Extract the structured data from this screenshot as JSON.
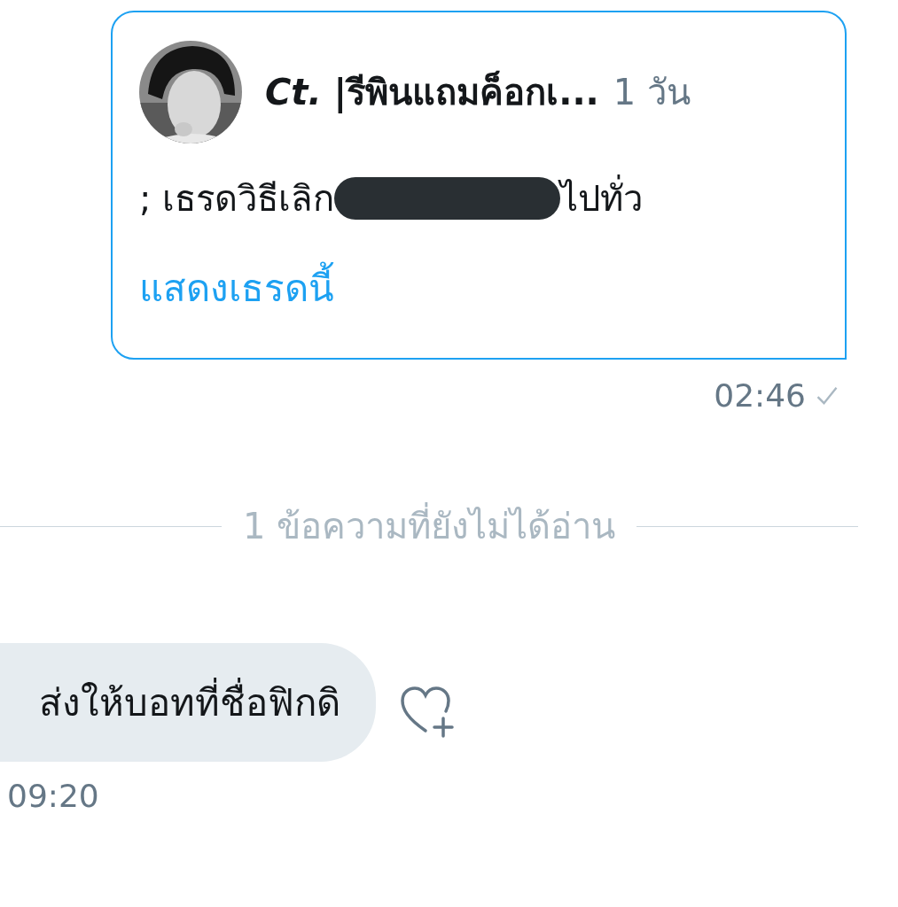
{
  "shared_tweet": {
    "author": "*Ct.* |รีพินแถมค็อกเ...",
    "age": "1 วัน",
    "parts": [
      {
        "kind": "text",
        "text": "; เธรดวิธีเลิก"
      },
      {
        "kind": "redaction"
      },
      {
        "kind": "text",
        "text": "ไปทั่ว"
      }
    ],
    "link": "แสดงเธรดนี้"
  },
  "sent_time": "02:46",
  "unread_divider": "1 ข้อความที่ยังไม่ได้อ่าน",
  "received": {
    "text": "ส่งให้บอทที่ชื่อฟิกดิ",
    "time": "09:20"
  }
}
